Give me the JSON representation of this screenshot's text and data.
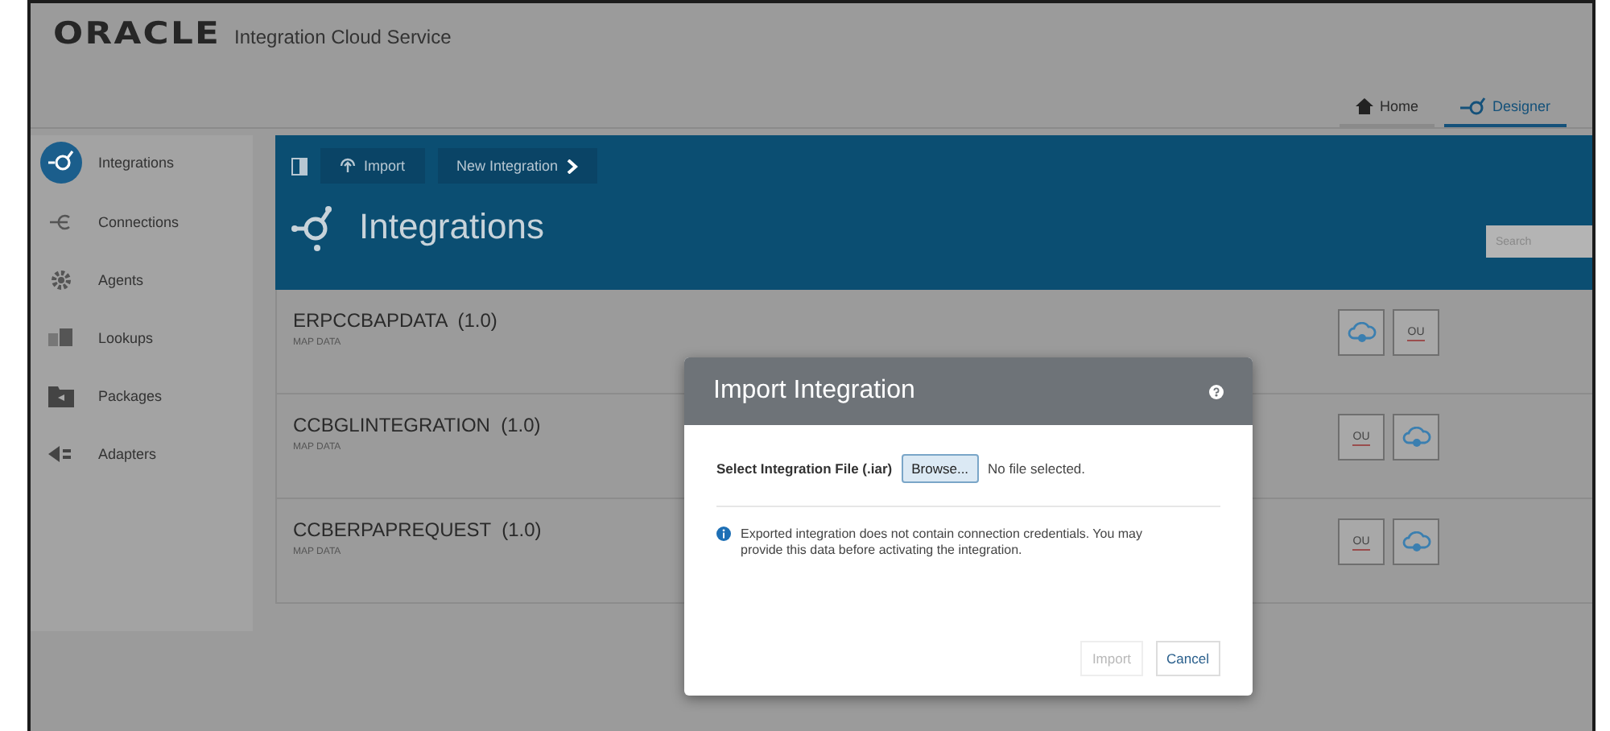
{
  "header": {
    "logo": "ORACLE",
    "product": "Integration Cloud Service",
    "tabs": [
      {
        "label": "Home",
        "kind": "home",
        "selected": false
      },
      {
        "label": "Designer",
        "kind": "designer",
        "selected": true
      }
    ]
  },
  "sidebar": {
    "items": [
      {
        "label": "Integrations",
        "kind": "integrations",
        "selected": true
      },
      {
        "label": "Connections",
        "kind": "connections",
        "selected": false
      },
      {
        "label": "Agents",
        "kind": "agents",
        "selected": false
      },
      {
        "label": "Lookups",
        "kind": "lookups",
        "selected": false
      },
      {
        "label": "Packages",
        "kind": "packages",
        "selected": false
      },
      {
        "label": "Adapters",
        "kind": "adapters",
        "selected": false
      }
    ]
  },
  "toolbar": {
    "buttons": [
      {
        "label": "Import",
        "kind": "import"
      },
      {
        "label": "New Integration",
        "kind": "new"
      }
    ]
  },
  "page_title": "Integrations",
  "search": {
    "placeholder": "Search"
  },
  "integrations": [
    {
      "name": "ERPCCBAPDATA  (1.0)",
      "subtitle": "MAP DATA",
      "adapters": [
        {
          "kind": "cloud"
        },
        {
          "kind": "text",
          "label": "OU"
        }
      ]
    },
    {
      "name": "CCBGLINTEGRATION  (1.0)",
      "subtitle": "MAP DATA",
      "adapters": [
        {
          "kind": "text",
          "label": "OU"
        },
        {
          "kind": "cloud"
        }
      ]
    },
    {
      "name": "CCBERPAPREQUEST  (1.0)",
      "subtitle": "MAP DATA",
      "adapters": [
        {
          "kind": "text",
          "label": "OU"
        },
        {
          "kind": "cloud"
        }
      ]
    }
  ],
  "dialog": {
    "title": "Import Integration",
    "file_label": "Select Integration File (.iar)",
    "browse": "Browse...",
    "file_status": "No file selected.",
    "info": "Exported integration does not contain connection credentials. You may provide this data before activating the integration.",
    "buttons": [
      {
        "label": "Import",
        "disabled": true
      },
      {
        "label": "Cancel",
        "disabled": false
      }
    ]
  }
}
